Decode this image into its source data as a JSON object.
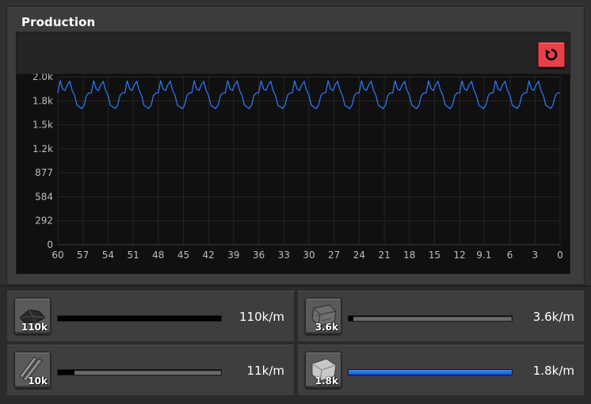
{
  "panel": {
    "title": "Production"
  },
  "reset_button": {
    "icon": "reset-icon",
    "color": "#e8404a"
  },
  "chart_data": {
    "type": "line",
    "title": "",
    "xlabel": "",
    "ylabel": "",
    "x_ticks": [
      "60",
      "57",
      "54",
      "51",
      "48",
      "45",
      "42",
      "39",
      "36",
      "33",
      "30",
      "27",
      "24",
      "21",
      "18",
      "15",
      "12",
      "9.1",
      "6",
      "3",
      "0"
    ],
    "y_ticks": [
      "0",
      "292",
      "584",
      "877",
      "1.2k",
      "1.5k",
      "1.8k",
      "2.0k"
    ],
    "ylim": [
      0,
      2046
    ],
    "xlim": [
      60,
      0
    ],
    "grid": true,
    "series": [
      {
        "color": "#2f7dff",
        "period_seconds": 4.0,
        "cycle_shape": [
          1850,
          2000,
          1900,
          1880,
          1950,
          1990,
          1880,
          1820,
          1700,
          1680,
          1660,
          1700,
          1820,
          1850
        ],
        "cycles": 15,
        "range": [
          1660,
          2000
        ]
      }
    ]
  },
  "items": [
    {
      "icon": "coal-icon",
      "count": "110k",
      "rate": "110k/m",
      "fill": 1.0,
      "bar_color": "#000000"
    },
    {
      "icon": "stone-brick-icon",
      "count": "3.6k",
      "rate": "3.6k/m",
      "fill": 0.03,
      "bar_color": "#000000"
    },
    {
      "icon": "iron-stick-icon",
      "count": "10k",
      "rate": "11k/m",
      "fill": 0.1,
      "bar_color": "#000000"
    },
    {
      "icon": "iron-plate-icon",
      "count": "1.8k",
      "rate": "1.8k/m",
      "fill": 1.0,
      "bar_color": "#1a6cff"
    }
  ]
}
